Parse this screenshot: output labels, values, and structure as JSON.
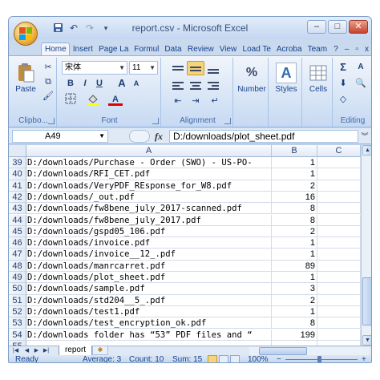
{
  "window": {
    "title": "report.csv - Microsoft Excel"
  },
  "qat_icons": [
    "save-icon",
    "undo-icon",
    "redo-icon",
    "customize-icon"
  ],
  "ribbon_tabs": [
    "Home",
    "Insert",
    "Page La",
    "Formul",
    "Data",
    "Review",
    "View",
    "Load Te",
    "Acroba",
    "Team"
  ],
  "ribbon": {
    "clipboard": {
      "paste": "Paste",
      "label": "Clipbo..."
    },
    "font": {
      "name": "宋体",
      "size": "11",
      "bold": "B",
      "italic": "I",
      "underline": "U",
      "grow": "A",
      "shrink": "A",
      "color_a": "A",
      "label": "Font"
    },
    "alignment": {
      "label": "Alignment"
    },
    "number": {
      "label": "Number",
      "icon": "%"
    },
    "styles": {
      "label": "Styles",
      "icon": "A"
    },
    "cells": {
      "label": "Cells"
    },
    "editing": {
      "label": "Editing",
      "sum": "Σ",
      "sort": "A"
    }
  },
  "formula_bar": {
    "name_box": "A49",
    "fx": "fx",
    "content": "D:/downloads/plot_sheet.pdf"
  },
  "columns": [
    "A",
    "B",
    "C"
  ],
  "rows": [
    {
      "num": "39",
      "a": "D:/downloads/Purchase - Order (SWO) - US-PO-",
      "b": "1"
    },
    {
      "num": "40",
      "a": "D:/downloads/RFI_CET.pdf",
      "b": "1"
    },
    {
      "num": "41",
      "a": "D:/downloads/VeryPDF_REsponse_for_W8.pdf",
      "b": "2"
    },
    {
      "num": "42",
      "a": "D:/downloads/_out.pdf",
      "b": "16"
    },
    {
      "num": "43",
      "a": "D:/downloads/fw8bene_july_2017-scanned.pdf",
      "b": "8"
    },
    {
      "num": "44",
      "a": "D:/downloads/fw8bene_july_2017.pdf",
      "b": "8"
    },
    {
      "num": "45",
      "a": "D:/downloads/gspd05_106.pdf",
      "b": "2"
    },
    {
      "num": "46",
      "a": "D:/downloads/invoice.pdf",
      "b": "1"
    },
    {
      "num": "47",
      "a": "D:/downloads/invoice__12_.pdf",
      "b": "1"
    },
    {
      "num": "48",
      "a": "D:/downloads/manrcarret.pdf",
      "b": "89"
    },
    {
      "num": "49",
      "a": "D:/downloads/plot_sheet.pdf",
      "b": "1"
    },
    {
      "num": "50",
      "a": "D:/downloads/sample.pdf",
      "b": "3"
    },
    {
      "num": "51",
      "a": "D:/downloads/std204__5_.pdf",
      "b": "2"
    },
    {
      "num": "52",
      "a": "D:/downloads/test1.pdf",
      "b": "1"
    },
    {
      "num": "53",
      "a": "D:/downloads/test_encryption_ok.pdf",
      "b": "8"
    },
    {
      "num": "54",
      "a": "D:/downloads folder has “53” PDF files and “",
      "b": "199"
    },
    {
      "num": "55",
      "a": "",
      "b": ""
    }
  ],
  "sheet_tab": "report",
  "status": {
    "ready": "Ready",
    "average": "Average: 3",
    "count": "Count: 10",
    "sum": "Sum: 15",
    "zoom": "100%",
    "minus": "−",
    "plus": "+"
  },
  "colors": {
    "office_logo": [
      "#e2521f",
      "#7fba00",
      "#00a4ef",
      "#ffb900"
    ]
  }
}
